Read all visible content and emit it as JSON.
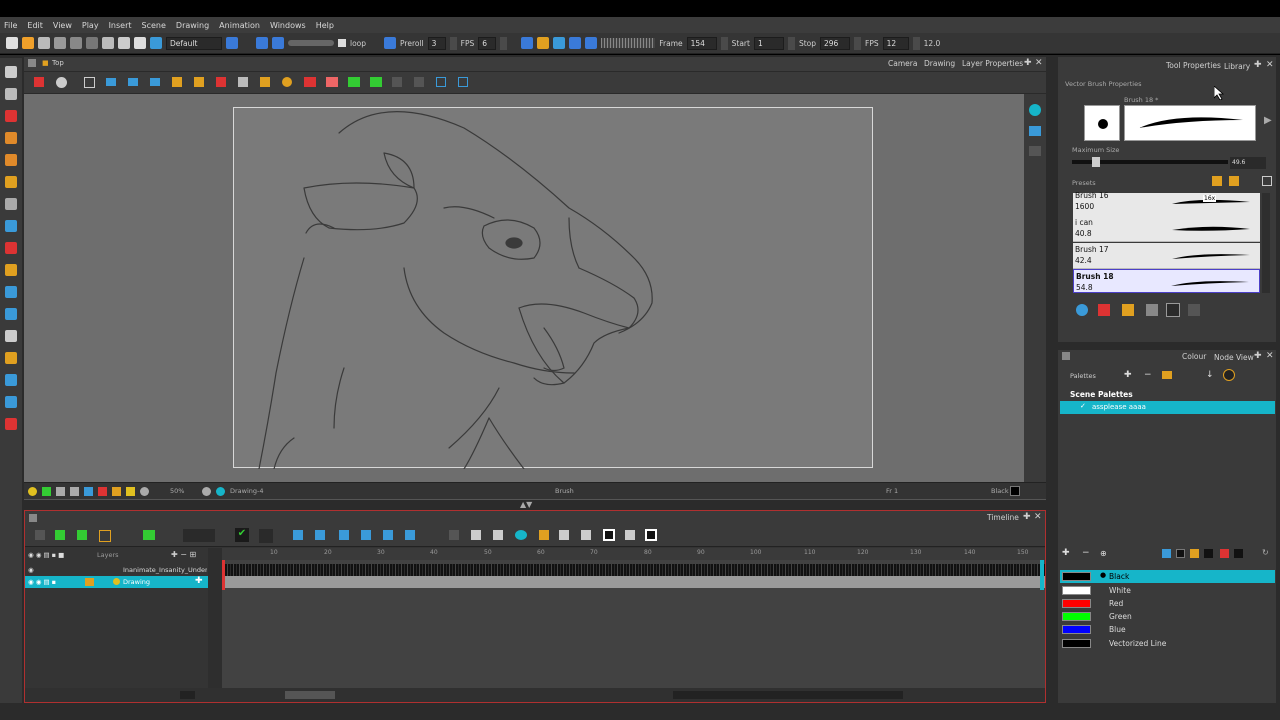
{
  "menu": [
    "File",
    "Edit",
    "View",
    "Play",
    "Insert",
    "Scene",
    "Drawing",
    "Animation",
    "Windows",
    "Help"
  ],
  "toolbar": {
    "workspace_select": "Default",
    "loop_label": "loop",
    "preroll_label": "Preroll",
    "preroll_value": "3",
    "fps_label": "FPS",
    "fps_value": "6",
    "frame_label": "Frame",
    "frame_value": "154",
    "start_label": "Start",
    "start_value": "1",
    "stop_label": "Stop",
    "stop_value": "296",
    "fps2_label": "FPS",
    "fps2_value": "12",
    "fps2_readout": "12.0"
  },
  "camera_view": {
    "title": "Top",
    "tabs": [
      "Camera",
      "Drawing",
      "Layer Properties"
    ],
    "status_zoom": "50%",
    "status_drawing": "Drawing-4",
    "status_tool": "Brush",
    "status_frame": "Fr 1",
    "status_colour": "Black"
  },
  "tool_properties": {
    "tabs": [
      "Tool Properties",
      "Library"
    ],
    "header": "Vector Brush Properties",
    "current_brush": "Brush 18 *",
    "max_size_label": "Maximum Size",
    "max_size_value": "49.6",
    "presets_label": "Presets",
    "presets": [
      {
        "name": "Brush 16",
        "size": "1600",
        "badge": "16x"
      },
      {
        "name": "i can",
        "size": "40.8"
      },
      {
        "name": "Brush 17",
        "size": "42.4"
      },
      {
        "name": "Brush 18",
        "size": "54.8",
        "selected": true
      }
    ]
  },
  "colour_panel": {
    "tabs": [
      "Colour",
      "Node View"
    ],
    "palettes_label": "Palettes",
    "scene_palettes_label": "Scene Palettes",
    "selected_palette": "assplease aaaa",
    "colours": [
      {
        "name": "Black",
        "hex": "#000000",
        "selected": true
      },
      {
        "name": "White",
        "hex": "#ffffff"
      },
      {
        "name": "Red",
        "hex": "#ff0000"
      },
      {
        "name": "Green",
        "hex": "#00ff00"
      },
      {
        "name": "Blue",
        "hex": "#0000ff"
      },
      {
        "name": "Vectorized Line",
        "hex": "#000000"
      }
    ]
  },
  "timeline": {
    "tab": "Timeline",
    "layers_header": "Layers",
    "layers": [
      {
        "name": "Inanimate_Insanity_Underta",
        "type": "sound"
      },
      {
        "name": "Drawing",
        "type": "drawing",
        "selected": true
      }
    ],
    "ruler_ticks": [
      "10",
      "20",
      "30",
      "40",
      "50",
      "60",
      "70",
      "80",
      "90",
      "100",
      "110",
      "120",
      "130",
      "140",
      "150"
    ]
  },
  "colors": {
    "accent": "#16b5c9",
    "panel": "#3a3a3a",
    "stage": "#7a7a7a",
    "selection_border": "#4b3fc8",
    "timeline_border": "#b03030"
  }
}
